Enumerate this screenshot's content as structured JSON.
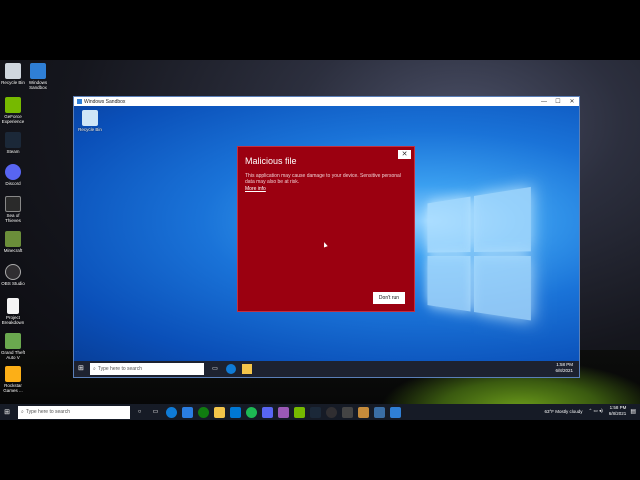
{
  "host_desktop_icons": [
    {
      "name": "recycle-bin-icon",
      "label": "Recycle Bin",
      "color": "#cfd6de"
    },
    {
      "name": "windows-sandbox-icon",
      "label": "Windows Sandbox",
      "color": "#2f7fd6"
    },
    {
      "name": "geforce-experience-icon",
      "label": "GeForce Experience",
      "color": "#76b900"
    },
    {
      "name": "steam-icon",
      "label": "Steam",
      "color": "#1b2838"
    },
    {
      "name": "discord-icon",
      "label": "Discord",
      "color": "#5865f2"
    },
    {
      "name": "sea-of-thieves-icon",
      "label": "Sea of Thieves",
      "color": "#2a2a2a"
    },
    {
      "name": "minecraft-icon",
      "label": "Minecraft",
      "color": "#6b8e3a"
    },
    {
      "name": "obs-studio-icon",
      "label": "OBS Studio",
      "color": "#302e31"
    },
    {
      "name": "project-breakdown-icon",
      "label": "Project Breakdown",
      "color": "#f4f4f4"
    },
    {
      "name": "gta-v-icon",
      "label": "Grand Theft Auto V",
      "color": "#6aa84f"
    },
    {
      "name": "rockstar-games-icon",
      "label": "Rockstar Games ...",
      "color": "#fcaf17"
    }
  ],
  "sandbox_window": {
    "title": "Windows Sandbox",
    "minimize": "—",
    "maximize": "☐",
    "close": "✕",
    "inner_desktop_icon": {
      "label": "Recycle Bin"
    },
    "taskbar": {
      "search_placeholder": "Type here to search",
      "time": "1:58 PM",
      "date": "6/8/2021"
    }
  },
  "dialog": {
    "title": "Malicious file",
    "body": "This application may cause damage to your device. Sensitive personal data may also be at risk.",
    "link": "More info",
    "button": "Don't run",
    "close": "✕",
    "background": "#9b0010"
  },
  "host_taskbar": {
    "search_placeholder": "Type here to search",
    "weather": "63°F  Mostly cloudy",
    "time": "1:58 PM",
    "date": "6/8/2021"
  }
}
